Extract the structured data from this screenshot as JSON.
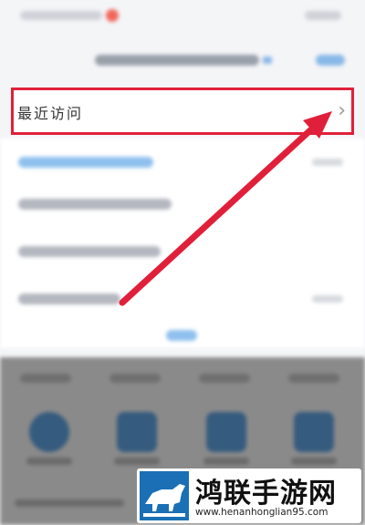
{
  "recent_visits": {
    "label": "最近访问",
    "chevron": "›"
  },
  "highlight_color": "#e0203a",
  "watermark": {
    "title": "鸿联手游网",
    "url": "www.henanhonglian95.com",
    "logo": "bull-logo-icon"
  }
}
